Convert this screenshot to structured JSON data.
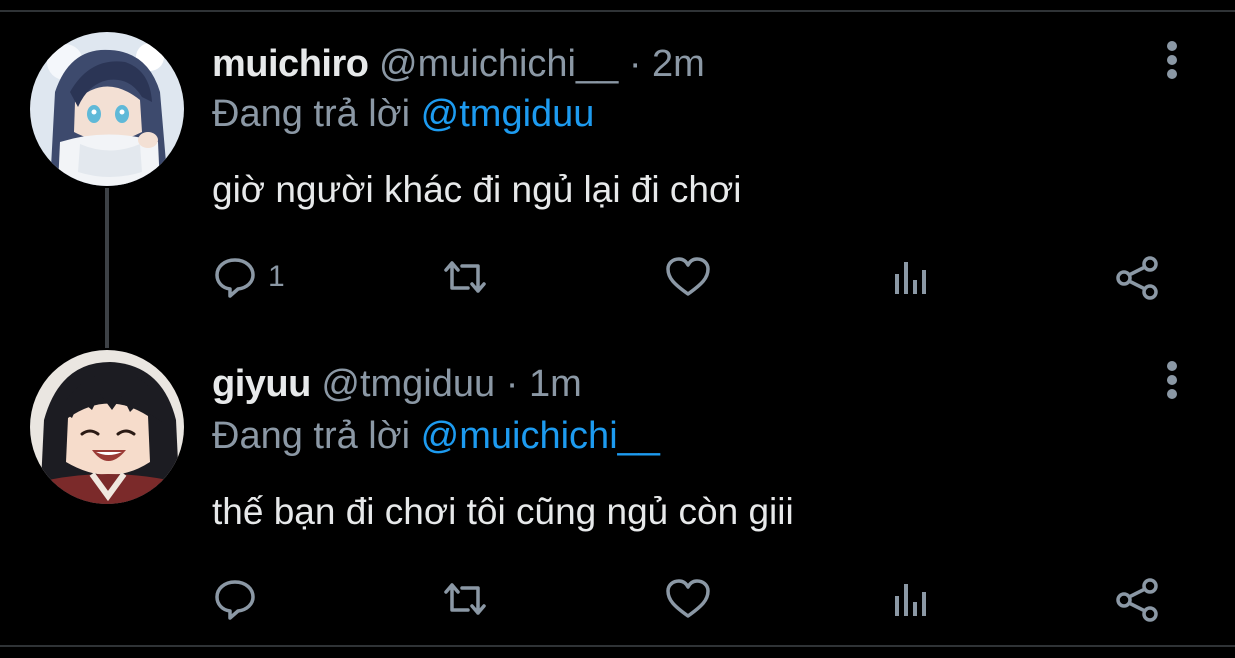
{
  "colors": {
    "background": "#000000",
    "name": "#e7e9ea",
    "secondary_text": "#8b98a5",
    "mention": "#1d9bf0",
    "thread_line": "#3d4146"
  },
  "tweets": [
    {
      "name": "muichiro",
      "handle": "@muichichi__",
      "separator": "·",
      "time": "2m",
      "reply_prefix": "Đang trả lời",
      "reply_to": "@tmgiduu",
      "text": "giờ người khác đi ngủ lại đi chơi",
      "reply_count": "1",
      "avatar_icon": "avatar-muichiro",
      "more_icon": "more-vertical-icon"
    },
    {
      "name": "giyuu",
      "handle": "@tmgiduu",
      "separator": "·",
      "time": "1m",
      "reply_prefix": "Đang trả lời",
      "reply_to": "@muichichi__",
      "text": "thế bạn đi chơi tôi cũng ngủ còn giii",
      "reply_count": "",
      "avatar_icon": "avatar-giyuu",
      "more_icon": "more-vertical-icon"
    }
  ],
  "action_icons": [
    "reply-icon",
    "retweet-icon",
    "like-icon",
    "analytics-icon",
    "share-icon"
  ]
}
